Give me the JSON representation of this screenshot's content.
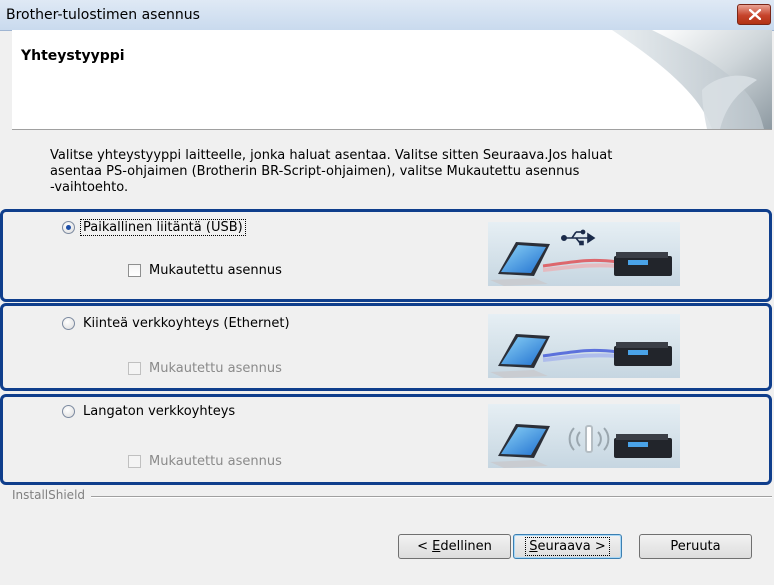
{
  "window": {
    "title": "Brother-tulostimen asennus",
    "close_icon": "close-icon"
  },
  "header": {
    "title": "Yhteystyyppi"
  },
  "intro": {
    "line1": "Valitse yhteystyyppi laitteelle, jonka haluat asentaa. Valitse sitten Seuraava.Jos haluat",
    "line2": "asentaa PS-ohjaimen (Brotherin BR-Script-ohjaimen), valitse Mukautettu asennus",
    "line3": "-vaihtoehto."
  },
  "options": [
    {
      "label": "Paikallinen liitäntä (USB)",
      "selected": true,
      "custom_label": "Mukautettu asennus",
      "custom_enabled": true,
      "custom_checked": false
    },
    {
      "label": "Kiinteä verkkoyhteys (Ethernet)",
      "selected": false,
      "custom_label": "Mukautettu asennus",
      "custom_enabled": false,
      "custom_checked": false
    },
    {
      "label": "Langaton verkkoyhteys",
      "selected": false,
      "custom_label": "Mukautettu asennus",
      "custom_enabled": false,
      "custom_checked": false
    }
  ],
  "footer": {
    "group_label": "InstallShield",
    "back_prefix": "< ",
    "back_key": "E",
    "back_rest": "dellinen",
    "next_key": "S",
    "next_rest": "euraava >",
    "cancel": "Peruuta"
  },
  "colors": {
    "highlight_frame": "#0f3e8c",
    "usb_cable": "#e0494d",
    "ethernet_cable": "#3f55d8"
  }
}
